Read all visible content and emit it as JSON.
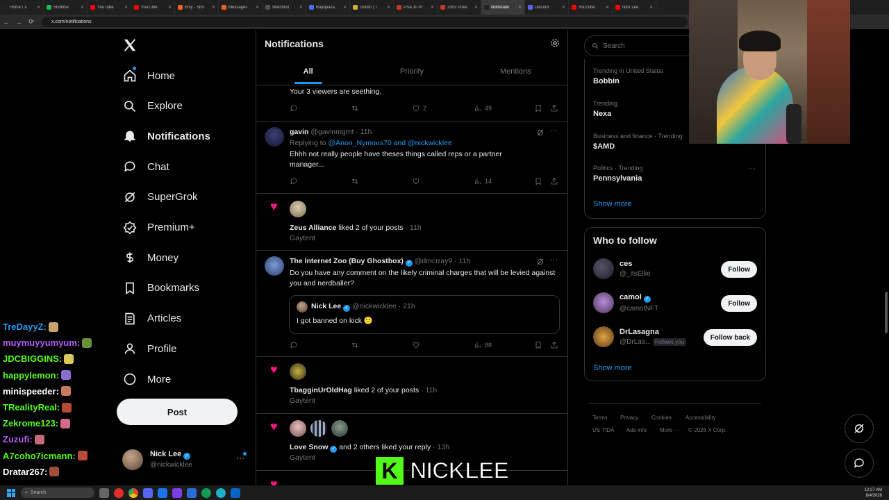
{
  "browser": {
    "tabs": [
      {
        "label": "Home / X",
        "color": "#222",
        "active": false
      },
      {
        "label": "Shotime",
        "color": "#1db954",
        "active": false
      },
      {
        "label": "YouTube",
        "color": "#ff0000",
        "active": false
      },
      {
        "label": "YouTube",
        "color": "#ff0000",
        "active": false
      },
      {
        "label": "Etsy - Sho",
        "color": "#f1641e",
        "active": false
      },
      {
        "label": "Messages",
        "color": "#f1641e",
        "active": false
      },
      {
        "label": "Watchlist",
        "color": "#555",
        "active": false
      },
      {
        "label": "Rayquaza",
        "color": "#4a6cf7",
        "active": false
      },
      {
        "label": "Goldin | T",
        "color": "#d4af37",
        "active": false
      },
      {
        "label": "PSA 10 Pr",
        "color": "#c0392b",
        "active": false
      },
      {
        "label": "2002 Poke",
        "color": "#c0392b",
        "active": false
      },
      {
        "label": "Notificatio",
        "color": "#222",
        "active": true
      },
      {
        "label": "Discord",
        "color": "#5865f2",
        "active": false
      },
      {
        "label": "YouTube",
        "color": "#ff0000",
        "active": false
      },
      {
        "label": "Nick Lee",
        "color": "#ff0000",
        "active": false
      }
    ],
    "url": "x.com/notifications"
  },
  "sidebar": {
    "items": [
      {
        "label": "Home",
        "icon": "home-icon",
        "bold": false
      },
      {
        "label": "Explore",
        "icon": "search-icon",
        "bold": false
      },
      {
        "label": "Notifications",
        "icon": "bell-icon",
        "bold": true
      },
      {
        "label": "Chat",
        "icon": "chat-icon",
        "bold": false
      },
      {
        "label": "SuperGrok",
        "icon": "grok-icon",
        "bold": false
      },
      {
        "label": "Premium+",
        "icon": "verified-icon",
        "bold": false
      },
      {
        "label": "Money",
        "icon": "money-icon",
        "bold": false
      },
      {
        "label": "Bookmarks",
        "icon": "bookmark-icon",
        "bold": false
      },
      {
        "label": "Articles",
        "icon": "articles-icon",
        "bold": false
      },
      {
        "label": "Profile",
        "icon": "person-icon",
        "bold": false
      },
      {
        "label": "More",
        "icon": "more-circle-icon",
        "bold": false
      }
    ],
    "post_label": "Post",
    "account": {
      "name": "Nick Lee",
      "handle": "@nickwicklee"
    }
  },
  "main": {
    "title": "Notifications",
    "tabs": [
      "All",
      "Priority",
      "Mentions"
    ],
    "items": [
      {
        "type": "tail",
        "text": "Your 3 viewers are seething.",
        "likes": "2",
        "views": "49"
      },
      {
        "type": "reply",
        "name": "gavin",
        "handle": "@gavinmgmt",
        "time": "· 11h",
        "replying_prefix": "Replying to",
        "replying_to": "@Anon_Nymous70 and @nickwicklee",
        "text": "Ehhh not really people have theses things called reps or a partner manager...",
        "views": "14"
      },
      {
        "type": "like",
        "name": "Zeus Alliance",
        "action": "liked 2 of your posts",
        "time": "· 11h",
        "sub": "Gaytent"
      },
      {
        "type": "quote",
        "name": "The Internet Zoo (Buy Ghostbox)",
        "handle": "@dmcrray9",
        "time": "· 11h",
        "text": "Do you have any comment on the likely criminal charges that will be levied against you and nerdballer?",
        "quoted_name": "Nick Lee",
        "quoted_handle": "@nickwicklee",
        "quoted_time": "· 21h",
        "quoted_text": "I got banned on kick 🙂",
        "views": "88"
      },
      {
        "type": "like",
        "name": "TbagginUrOldHag",
        "action": "liked 2 of your posts",
        "time": "· 11h",
        "sub": "Gaytent"
      },
      {
        "type": "like",
        "name": "Love Snow",
        "action": "and 2 others liked your reply",
        "time": "· 13h",
        "sub": "Gaytent"
      }
    ]
  },
  "right": {
    "search_placeholder": "Search",
    "trends": [
      {
        "context": "Trending in United States",
        "name": "Bobbin"
      },
      {
        "context": "Trending",
        "name": "Nexa"
      },
      {
        "context": "Business and finance · Trending",
        "name": "$AMD"
      },
      {
        "context": "Politics · Trending",
        "name": "Pennsylvania"
      }
    ],
    "show_more": "Show more",
    "who_title": "Who to follow",
    "who": [
      {
        "name": "ces",
        "handle": "@_itsEllie",
        "button": "Follow",
        "verified": false,
        "follows_you": ""
      },
      {
        "name": "camol",
        "handle": "@camolNFT",
        "button": "Follow",
        "verified": true,
        "follows_you": ""
      },
      {
        "name": "DrLasagna",
        "handle": "@DrLas...",
        "button": "Follow back",
        "verified": false,
        "follows_you": "Follows you"
      }
    ],
    "footer": [
      "Terms",
      "Privacy",
      "Cookies",
      "Accessibility",
      "US TIDA",
      "Ads info",
      "More ···",
      "© 2026 X Corp."
    ]
  },
  "stream_chat": [
    {
      "user": "TreDayyZ:",
      "color": "#1d9bf0"
    },
    {
      "user": "muymuyyumyum:",
      "color": "#b45af2"
    },
    {
      "user": "JDCBIGGINS:",
      "color": "#53fc18"
    },
    {
      "user": "happylemon:",
      "color": "#53fc18"
    },
    {
      "user": "minispeeder:",
      "color": "#ffffff"
    },
    {
      "user": "TRealityReal:",
      "color": "#53fc18"
    },
    {
      "user": "Zekrome123:",
      "color": "#53fc18"
    },
    {
      "user": "Zuzufi:",
      "color": "#b45af2"
    },
    {
      "user": "A7coho7icmann:",
      "color": "#53fc18"
    },
    {
      "user": "Dratar267:",
      "color": "#ffffff"
    }
  ],
  "overlay": {
    "brand": "NICKLEE",
    "logo_letter": "K"
  },
  "taskbar": {
    "search_placeholder": "Search",
    "time": "12:27 AM",
    "date": "8/4/2026"
  }
}
